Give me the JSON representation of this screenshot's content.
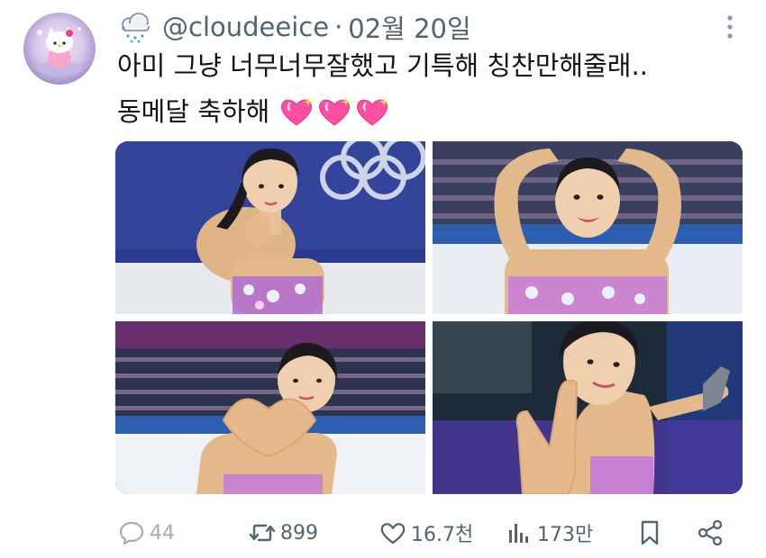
{
  "tweet": {
    "handle": "@cloudeeice",
    "separator": "·",
    "date": "02월 20일",
    "text_line1": "아미 그냥 너무너무잘했고 기특해 칭찬만해줄래..",
    "text_line2": "동메달 축하해",
    "emoji": [
      "sparkling-heart",
      "sparkling-heart",
      "sparkling-heart"
    ]
  },
  "author": {
    "avatar_icon": "hello-kitty-avatar",
    "name_emoji": "snow-cloud-icon"
  },
  "media": {
    "photos": [
      "skater-photo-1",
      "skater-photo-2",
      "skater-photo-3",
      "skater-photo-4"
    ]
  },
  "actions": {
    "replies": "44",
    "retweets": "899",
    "likes": "16.7천",
    "views": "173만"
  },
  "colors": {
    "text": "#0f1419",
    "secondary": "#536471",
    "heart_emoji": "#ff4fa3"
  }
}
